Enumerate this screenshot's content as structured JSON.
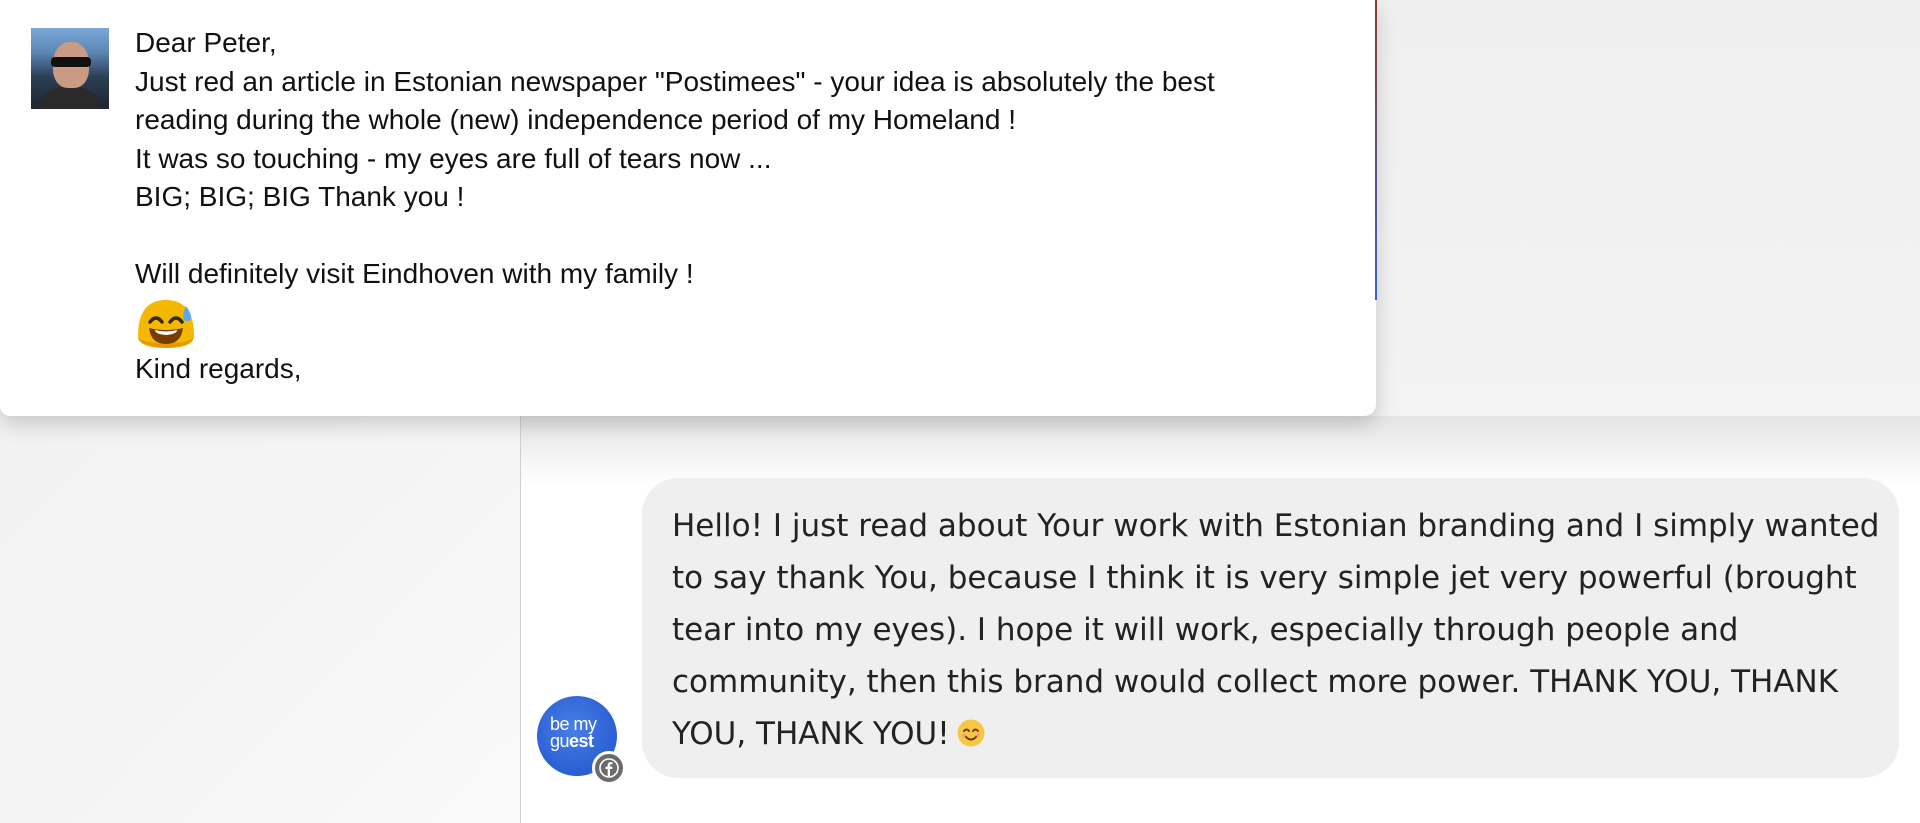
{
  "email": {
    "greeting": "Dear Peter,",
    "lines": [
      "Just red an article in Estonian newspaper \"Postimees\" - your idea is absolutely the best",
      "reading during the whole (new) independence period of my Homeland !",
      "It was so touching - my eyes are full of tears now ...",
      "BIG; BIG; BIG Thank you !"
    ],
    "visit_line": "Will definitely visit Eindhoven with my family !",
    "emoji_icon": "smiling-face-with-sweat-icon",
    "closing": "Kind regards,"
  },
  "chat": {
    "avatar_logo": {
      "part1": "be my",
      "part2a": "gu",
      "part2b": "est"
    },
    "badge_icon": "facebook-icon",
    "message_lines": [
      "Hello! I just read about Your work with Estonian branding and I simply wanted",
      "to say thank You, because I think it is very simple jet very powerful (brought",
      "tear into my eyes).  I hope it will work, especially through people and",
      "community, then this brand would collect more power. THANK YOU, THANK",
      "YOU, THANK YOU!"
    ],
    "smiley_icon": "smiling-face-icon"
  },
  "colors": {
    "avatar_blue": "#2d63d6",
    "bubble_bg": "#efefef",
    "emoji_yellow": "#f5b800"
  }
}
